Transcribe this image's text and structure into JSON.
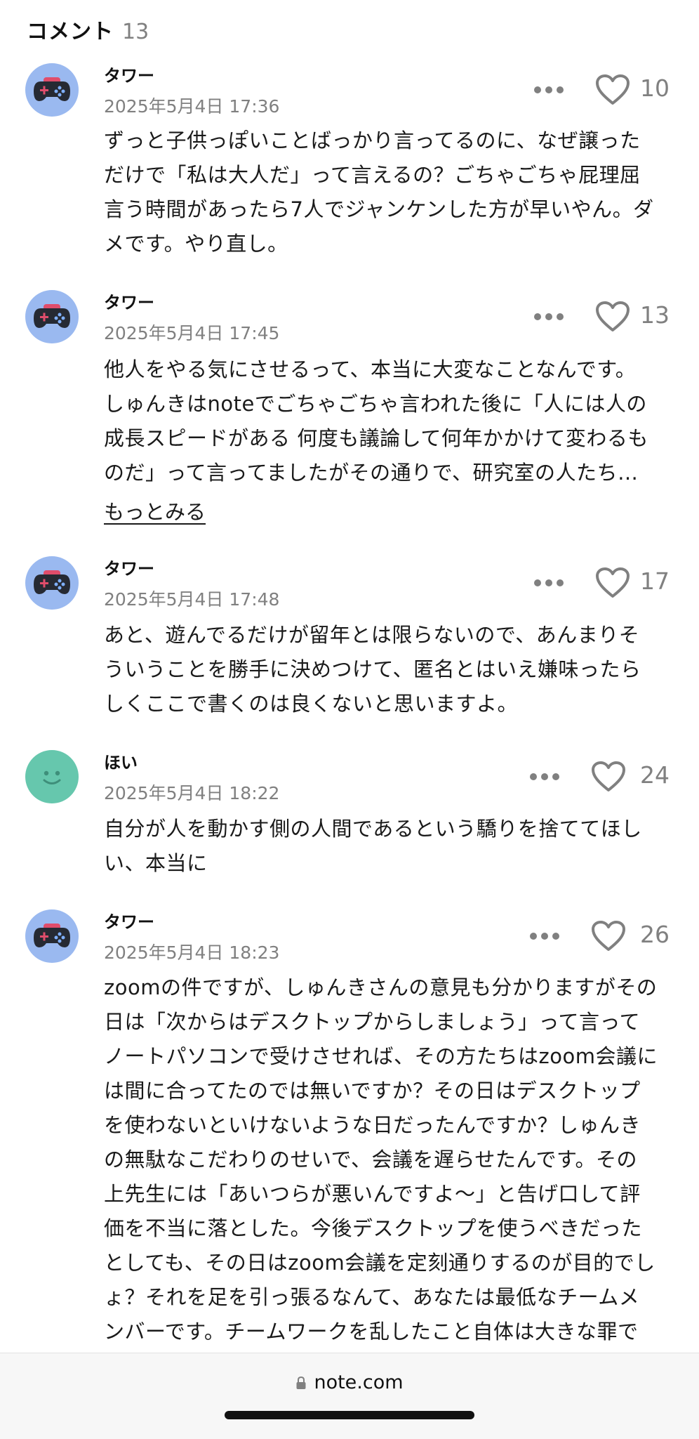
{
  "header": {
    "title": "コメント",
    "count": "13"
  },
  "comments": [
    {
      "author": "タワー",
      "date": "2025年5月4日 17:36",
      "likes": "10",
      "body": "ずっと子供っぽいことばっかり言ってるのに、なぜ譲った\nだけで「私は大人だ」って言えるの？ごちゃごちゃ屁理屈\n言う時間があったら7人でジャンケンした方が早いやん。ダ\nメです。やり直し。"
    },
    {
      "author": "タワー",
      "date": "2025年5月4日 17:45",
      "likes": "13",
      "body": "他人をやる気にさせるって、本当に大変なことなんです。\nしゅんきはnoteでごちゃごちゃ言われた後に「人には人の\n成長スピードがある 何度も議論して何年かかけて変わるも\nのだ」って言ってましたがその通りで、研究室の人たち…",
      "more_label": "もっとみる"
    },
    {
      "author": "タワー",
      "date": "2025年5月4日 17:48",
      "likes": "17",
      "body": "あと、遊んでるだけが留年とは限らないので、あんまりそ\nういうことを勝手に決めつけて、匿名とはいえ嫌味ったら\nしくここで書くのは良くないと思いますよ。"
    },
    {
      "author": "ほい",
      "date": "2025年5月4日 18:22",
      "likes": "24",
      "body": "自分が人を動かす側の人間であるという驕りを捨ててほし\nい、本当に"
    },
    {
      "author": "タワー",
      "date": "2025年5月4日 18:23",
      "likes": "26",
      "body": "zoomの件ですが、しゅんきさんの意見も分かりますがその\n日は「次からはデスクトップからしましょう」って言って\nノートパソコンで受けさせれば、その方たちはzoom会議に\nは間に合ってたのでは無いですか？その日はデスクトップ\nを使わないといけないような日だったんですか？しゅんき\nの無駄なこだわりのせいで、会議を遅らせたんです。その\n上先生には「あいつらが悪いんですよ〜」と告げ口して評\n価を不当に落とした。今後デスクトップを使うべきだった\nとしても、その日はzoom会議を定刻通りするのが目的でし\nょ？それを足を引っ張るなんて、あなたは最低なチームメ\nンバーです。チームワークを乱したこと自体は大きな罪で"
    }
  ],
  "browser": {
    "url": "note.com"
  },
  "icons": {
    "avatar_game": "gamepad-icon",
    "avatar_smile": "smiley-icon",
    "more": "more-horizontal-icon",
    "like": "heart-icon",
    "lock": "lock-icon"
  },
  "colors": {
    "avatar_blue": "#9ab9f0",
    "avatar_green": "#66c7ad",
    "secondary_text": "#808080"
  }
}
